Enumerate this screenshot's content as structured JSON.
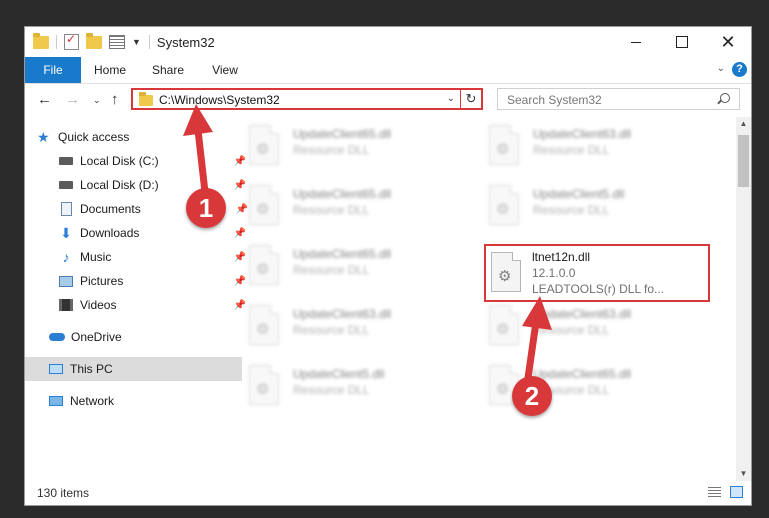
{
  "window": {
    "title": "System32",
    "minimize_icon": "minimize-icon",
    "maximize_icon": "maximize-icon",
    "close_icon": "close-icon",
    "close_glyph": "✕"
  },
  "ribbon": {
    "tabs": [
      {
        "label": "File"
      },
      {
        "label": "Home"
      },
      {
        "label": "Share"
      },
      {
        "label": "View"
      }
    ],
    "help_glyph": "?",
    "expand_glyph": "⌄"
  },
  "nav": {
    "back_glyph": "←",
    "forward_glyph": "→",
    "recent_glyph": "⌄",
    "up_glyph": "↑",
    "address": "C:\\Windows\\System32",
    "address_drop_glyph": "⌄",
    "refresh_glyph": "↻",
    "search_placeholder": "Search System32"
  },
  "sidebar": {
    "items": [
      {
        "label": "Quick access",
        "icon": "star-icon"
      },
      {
        "label": "Local Disk (C:)",
        "icon": "disk-icon"
      },
      {
        "label": "Local Disk (D:)",
        "icon": "disk-icon"
      },
      {
        "label": "Documents",
        "icon": "documents-icon"
      },
      {
        "label": "Downloads",
        "icon": "download-icon"
      },
      {
        "label": "Music",
        "icon": "music-icon"
      },
      {
        "label": "Pictures",
        "icon": "pictures-icon"
      },
      {
        "label": "Videos",
        "icon": "videos-icon"
      },
      {
        "label": "OneDrive",
        "icon": "cloud-icon"
      },
      {
        "label": "This PC",
        "icon": "computer-icon"
      },
      {
        "label": "Network",
        "icon": "network-icon"
      }
    ],
    "pin_glyph": "📌",
    "star_glyph": "★",
    "download_glyph": "⬇",
    "music_glyph": "♪"
  },
  "files": [
    {
      "name": "UpdateClient65.dll",
      "type": "Resource DLL"
    },
    {
      "name": "UpdateClient63.dll",
      "type": "Resource DLL"
    },
    {
      "name": "UpdateClient65.dll",
      "type": "Resource DLL"
    },
    {
      "name": "UpdateClient5.dll",
      "type": "Resource DLL"
    },
    {
      "name": "UpdateClient65.dll",
      "type": "Resource DLL"
    },
    {
      "name": "ltnet12n.dll",
      "version": "12.1.0.0",
      "description": "LEADTOOLS(r) DLL fo..."
    },
    {
      "name": "UpdateClient63.dll",
      "type": "Resource DLL"
    },
    {
      "name": "UpdateClient63.dll",
      "type": "Resource DLL"
    },
    {
      "name": "UpdateClient5.dll",
      "type": "Resource DLL"
    },
    {
      "name": "UpdateClient65.dll",
      "type": "Resource DLL"
    }
  ],
  "file_icon": "dll-file-icon",
  "gear_glyph": "⚙",
  "status": {
    "count": "130 items"
  },
  "markers": [
    {
      "label": "1"
    },
    {
      "label": "2"
    }
  ],
  "scroll": {
    "up_glyph": "▲",
    "down_glyph": "▼"
  },
  "colors": {
    "accent": "#1979ca",
    "highlight": "#d9383a"
  }
}
